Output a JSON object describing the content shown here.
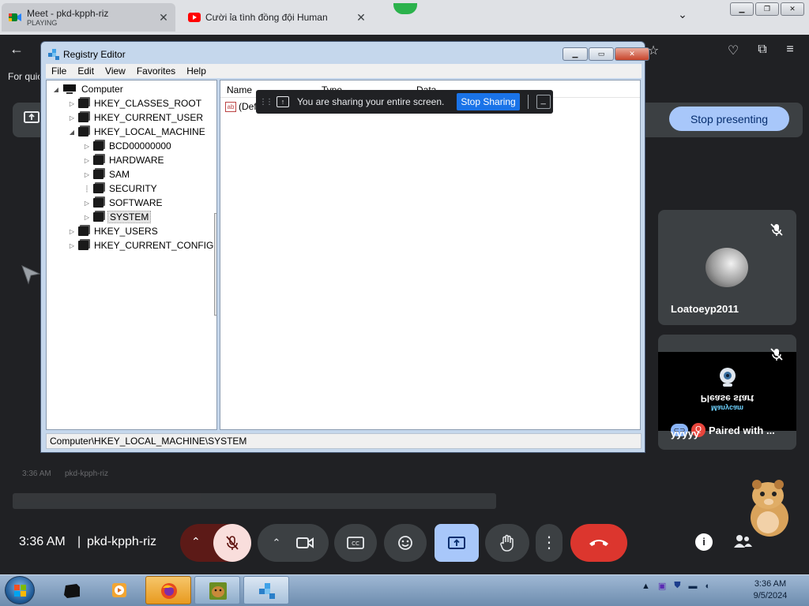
{
  "browser": {
    "tabs": [
      {
        "title": "Meet - pkd-kpph-riz",
        "subtitle": "PLAYING",
        "active": true
      },
      {
        "title": "Cười ỉa tình đồng đội Human",
        "subtitle": "",
        "active": false
      }
    ],
    "bookmarks_label": "For quic"
  },
  "meet": {
    "stop_presenting_label": "Stop presenting",
    "participants": [
      {
        "name": "Loatoeyp2011",
        "muted": true
      },
      {
        "name": "yyyyy",
        "muted": true,
        "camera_text": "Please start",
        "camera_subtext": "Manycam",
        "paired_label": "Paired with ..."
      }
    ],
    "ghost": {
      "time": "3:36 AM",
      "code": "pkd-kpph-riz"
    },
    "time": "3:36 AM",
    "separator": "|",
    "meeting_code": "pkd-kpph-riz",
    "colors": {
      "end_call": "#dc362e",
      "share_active": "#a8c7fa",
      "mic_off_bg": "#f9dedc"
    }
  },
  "sharing_bar": {
    "message": "You are sharing your entire screen.",
    "stop_label": "Stop Sharing",
    "hide_label": "_"
  },
  "regedit": {
    "title": "Registry Editor",
    "menu": [
      "File",
      "Edit",
      "View",
      "Favorites",
      "Help"
    ],
    "tree": [
      {
        "label": "Computer",
        "depth": 0,
        "expander": "open",
        "root": true
      },
      {
        "label": "HKEY_CLASSES_ROOT",
        "depth": 1,
        "expander": "closed"
      },
      {
        "label": "HKEY_CURRENT_USER",
        "depth": 1,
        "expander": "closed"
      },
      {
        "label": "HKEY_LOCAL_MACHINE",
        "depth": 1,
        "expander": "open"
      },
      {
        "label": "BCD00000000",
        "depth": 2,
        "expander": "closed"
      },
      {
        "label": "HARDWARE",
        "depth": 2,
        "expander": "closed"
      },
      {
        "label": "SAM",
        "depth": 2,
        "expander": "closed"
      },
      {
        "label": "SECURITY",
        "depth": 2,
        "expander": "none"
      },
      {
        "label": "SOFTWARE",
        "depth": 2,
        "expander": "closed"
      },
      {
        "label": "SYSTEM",
        "depth": 2,
        "expander": "closed",
        "selected": true
      },
      {
        "label": "HKEY_USERS",
        "depth": 1,
        "expander": "closed"
      },
      {
        "label": "HKEY_CURRENT_CONFIG",
        "depth": 1,
        "expander": "closed"
      }
    ],
    "columns": [
      "Name",
      "Type",
      "Data"
    ],
    "default_value_label": "(Def",
    "status_path": "Computer\\HKEY_LOCAL_MACHINE\\SYSTEM"
  },
  "taskbar": {
    "clock_time": "3:36 AM",
    "clock_date": "9/5/2024"
  }
}
